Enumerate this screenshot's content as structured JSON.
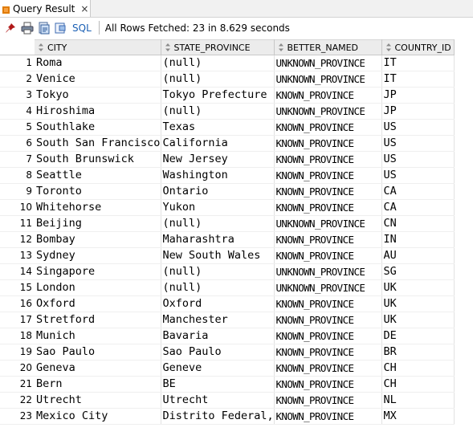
{
  "tab": {
    "title": "Query Result",
    "close_glyph": "×"
  },
  "toolbar": {
    "sql_label": "SQL",
    "status_text": "All Rows Fetched: 23 in 8.629 seconds"
  },
  "columns": [
    "CITY",
    "STATE_PROVINCE",
    "BETTER_NAMED",
    "COUNTRY_ID"
  ],
  "rows": [
    {
      "n": "1",
      "city": "Roma",
      "state": "(null)",
      "better": "UNKNOWN_PROVINCE",
      "country": "IT"
    },
    {
      "n": "2",
      "city": "Venice",
      "state": "(null)",
      "better": "UNKNOWN_PROVINCE",
      "country": "IT"
    },
    {
      "n": "3",
      "city": "Tokyo",
      "state": "Tokyo Prefecture",
      "better": "KNOWN_PROVINCE",
      "country": "JP"
    },
    {
      "n": "4",
      "city": "Hiroshima",
      "state": "(null)",
      "better": "UNKNOWN_PROVINCE",
      "country": "JP"
    },
    {
      "n": "5",
      "city": "Southlake",
      "state": "Texas",
      "better": "KNOWN_PROVINCE",
      "country": "US"
    },
    {
      "n": "6",
      "city": "South San Francisco",
      "state": "California",
      "better": "KNOWN_PROVINCE",
      "country": "US"
    },
    {
      "n": "7",
      "city": "South Brunswick",
      "state": "New Jersey",
      "better": "KNOWN_PROVINCE",
      "country": "US"
    },
    {
      "n": "8",
      "city": "Seattle",
      "state": "Washington",
      "better": "KNOWN_PROVINCE",
      "country": "US"
    },
    {
      "n": "9",
      "city": "Toronto",
      "state": "Ontario",
      "better": "KNOWN_PROVINCE",
      "country": "CA"
    },
    {
      "n": "10",
      "city": "Whitehorse",
      "state": "Yukon",
      "better": "KNOWN_PROVINCE",
      "country": "CA"
    },
    {
      "n": "11",
      "city": "Beijing",
      "state": "(null)",
      "better": "UNKNOWN_PROVINCE",
      "country": "CN"
    },
    {
      "n": "12",
      "city": "Bombay",
      "state": "Maharashtra",
      "better": "KNOWN_PROVINCE",
      "country": "IN"
    },
    {
      "n": "13",
      "city": "Sydney",
      "state": "New South Wales",
      "better": "KNOWN_PROVINCE",
      "country": "AU"
    },
    {
      "n": "14",
      "city": "Singapore",
      "state": "(null)",
      "better": "UNKNOWN_PROVINCE",
      "country": "SG"
    },
    {
      "n": "15",
      "city": "London",
      "state": "(null)",
      "better": "UNKNOWN_PROVINCE",
      "country": "UK"
    },
    {
      "n": "16",
      "city": "Oxford",
      "state": "Oxford",
      "better": "KNOWN_PROVINCE",
      "country": "UK"
    },
    {
      "n": "17",
      "city": "Stretford",
      "state": "Manchester",
      "better": "KNOWN_PROVINCE",
      "country": "UK"
    },
    {
      "n": "18",
      "city": "Munich",
      "state": "Bavaria",
      "better": "KNOWN_PROVINCE",
      "country": "DE"
    },
    {
      "n": "19",
      "city": "Sao Paulo",
      "state": "Sao Paulo",
      "better": "KNOWN_PROVINCE",
      "country": "BR"
    },
    {
      "n": "20",
      "city": "Geneva",
      "state": "Geneve",
      "better": "KNOWN_PROVINCE",
      "country": "CH"
    },
    {
      "n": "21",
      "city": "Bern",
      "state": "BE",
      "better": "KNOWN_PROVINCE",
      "country": "CH"
    },
    {
      "n": "22",
      "city": "Utrecht",
      "state": "Utrecht",
      "better": "KNOWN_PROVINCE",
      "country": "NL"
    },
    {
      "n": "23",
      "city": "Mexico City",
      "state": "Distrito Federal,",
      "better": "KNOWN_PROVINCE",
      "country": "MX"
    }
  ],
  "icons": {
    "tab": "orange-square-icon",
    "pin": "pin-icon",
    "print": "print-icon",
    "export": "export-icon",
    "refresh": "refresh-icon",
    "sort": "sort-icon"
  },
  "colors": {
    "sql_link": "#1a5fb4",
    "tab_icon": "#e07b00"
  }
}
